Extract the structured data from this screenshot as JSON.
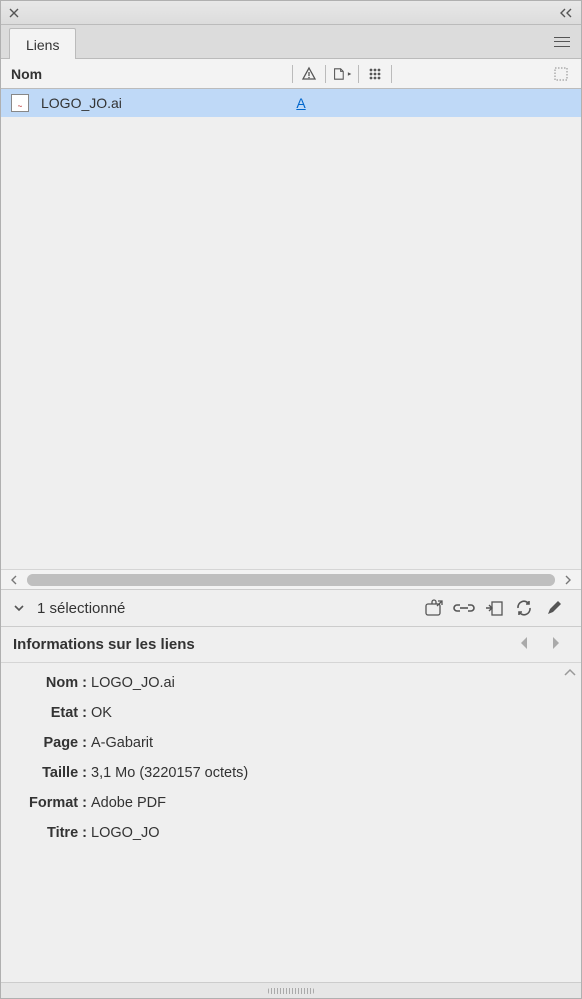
{
  "panel": {
    "tab_label": "Liens",
    "columns": {
      "name": "Nom"
    }
  },
  "links": [
    {
      "filename": "LOGO_JO.ai",
      "page_letter": "A"
    }
  ],
  "selection": {
    "count_label": "1 sélectionné"
  },
  "info": {
    "header": "Informations sur les liens",
    "labels": {
      "name": "Nom",
      "status": "Etat",
      "page": "Page",
      "size": "Taille",
      "format": "Format",
      "title": "Titre"
    },
    "values": {
      "name": "LOGO_JO.ai",
      "status": "OK",
      "page": "A-Gabarit",
      "size": "3,1 Mo (3220157 octets)",
      "format": "Adobe PDF",
      "title": "LOGO_JO"
    }
  }
}
